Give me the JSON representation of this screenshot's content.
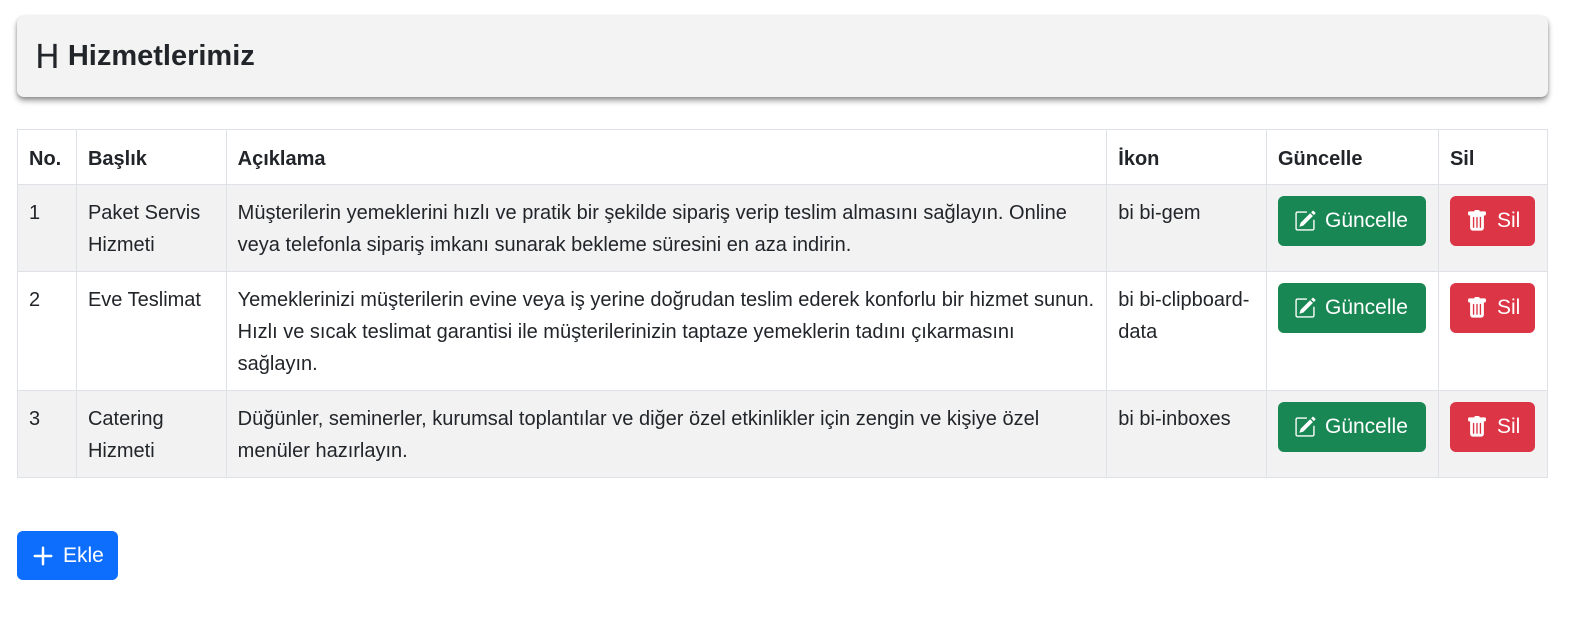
{
  "header": {
    "icon": "H",
    "title": "Hizmetlerimiz"
  },
  "table": {
    "columns": {
      "no": "No.",
      "title": "Başlık",
      "description": "Açıklama",
      "icon": "İkon",
      "update": "Güncelle",
      "delete": "Sil"
    },
    "rows": [
      {
        "no": "1",
        "title": "Paket Servis Hizmeti",
        "description": "Müşterilerin yemeklerini hızlı ve pratik bir şekilde sipariş verip teslim almasını sağlayın. Online veya telefonla sipariş imkanı sunarak bekleme süresini en aza indirin.",
        "icon": "bi bi-gem",
        "update_label": "Güncelle",
        "delete_label": "Sil"
      },
      {
        "no": "2",
        "title": "Eve Teslimat",
        "description": "Yemeklerinizi müşterilerin evine veya iş yerine doğrudan teslim ederek konforlu bir hizmet sunun. Hızlı ve sıcak teslimat garantisi ile müşterilerinizin taptaze yemeklerin tadını çıkarmasını sağlayın.",
        "icon": "bi bi-clipboard-data",
        "update_label": "Güncelle",
        "delete_label": "Sil"
      },
      {
        "no": "3",
        "title": "Catering Hizmeti",
        "description": "Düğünler, seminerler, kurumsal toplantılar ve diğer özel etkinlikler için zengin ve kişiye özel menüler hazırlayın.",
        "icon": "bi bi-inboxes",
        "update_label": "Güncelle",
        "delete_label": "Sil"
      }
    ]
  },
  "add_button": {
    "label": "Ekle",
    "icon": "plus-icon"
  },
  "colors": {
    "update": "#198754",
    "delete": "#dc3545",
    "primary": "#0d6efd",
    "header_bg": "#f3f3f3",
    "stripe": "#f2f2f2"
  },
  "icons": {
    "update": "pencil-square-icon",
    "delete": "trash-icon"
  }
}
